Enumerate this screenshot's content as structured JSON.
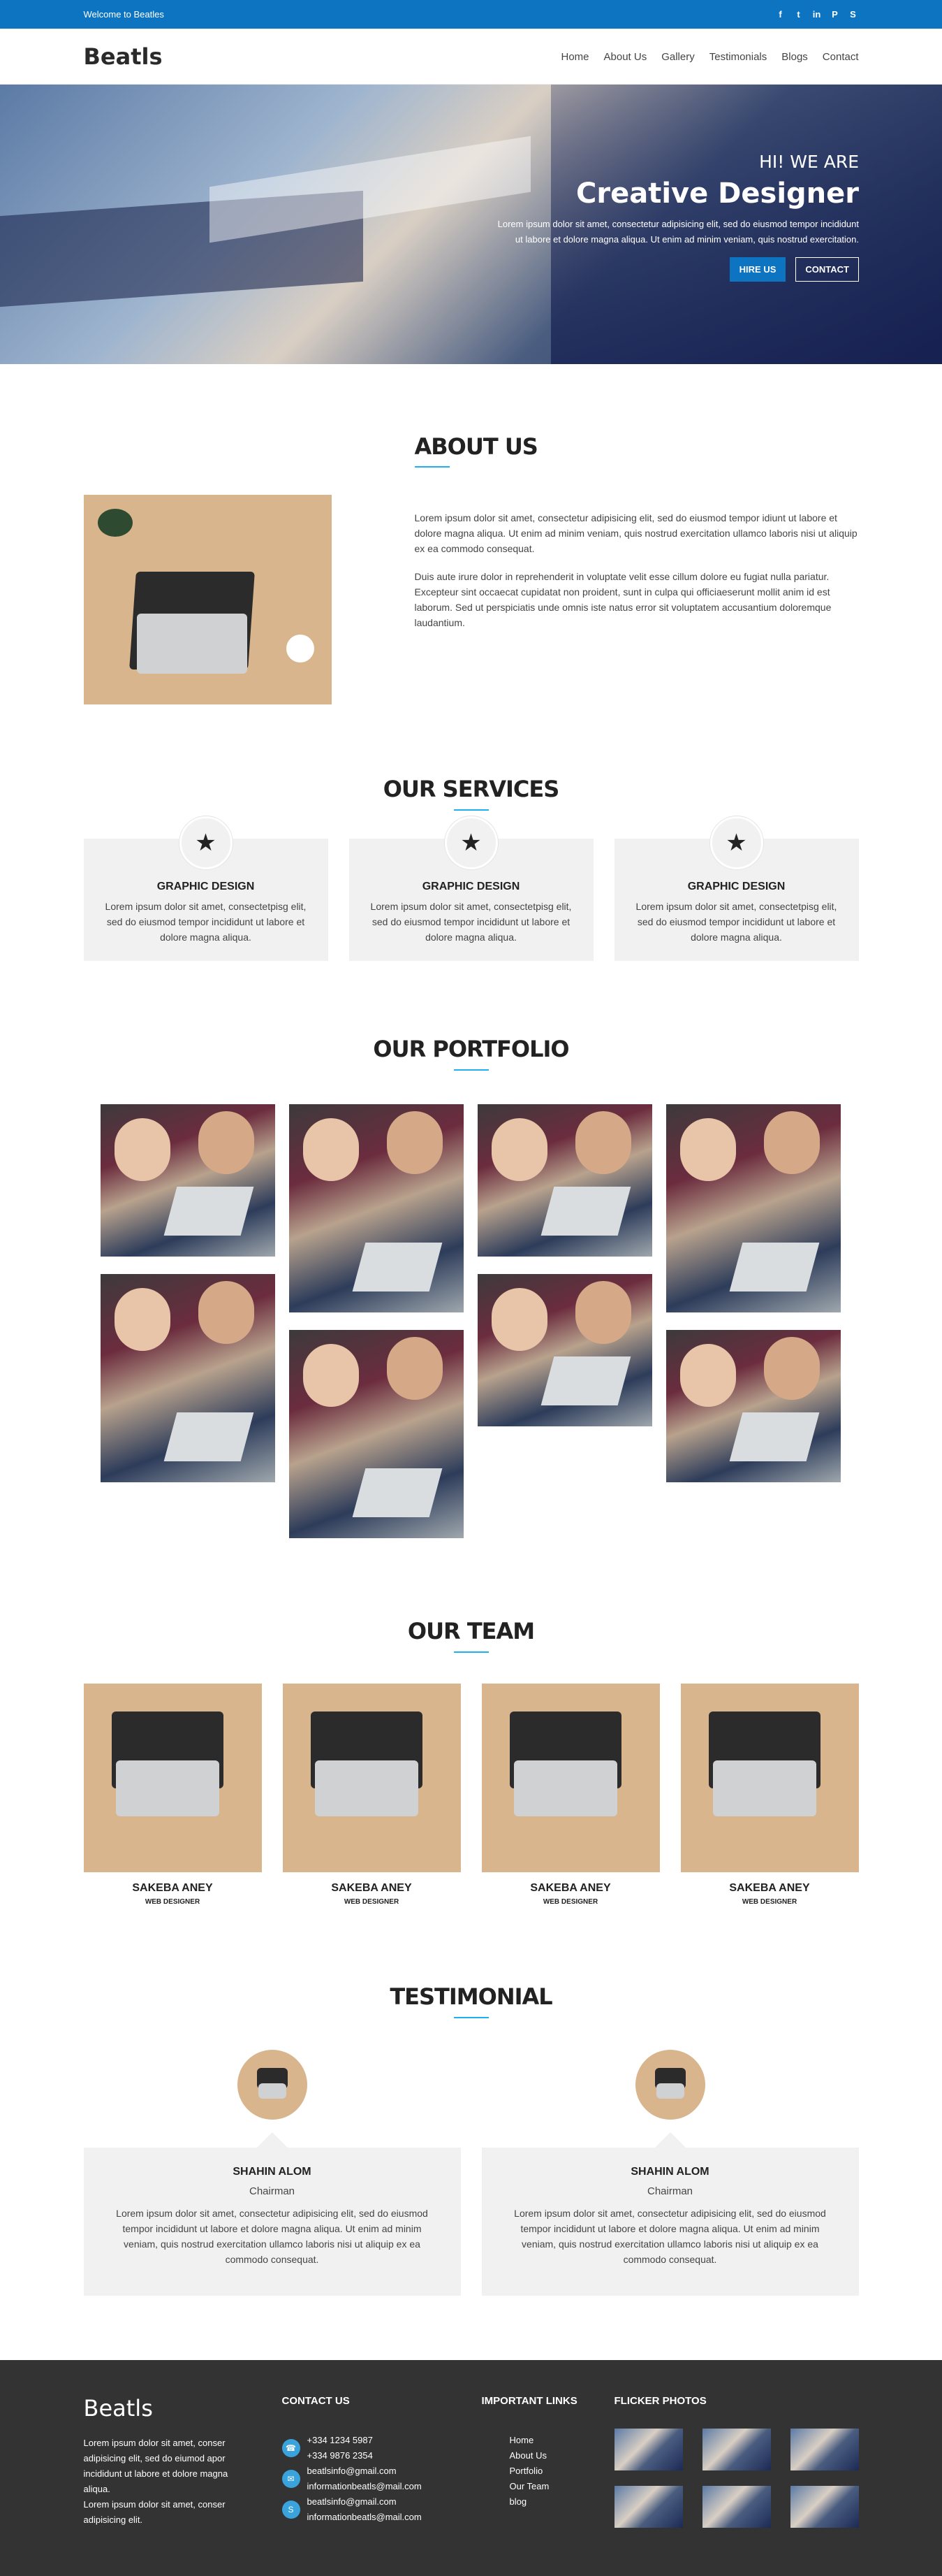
{
  "topbar": {
    "welcome": "Welcome to Beatles",
    "social_icons": [
      "facebook-icon",
      "twitter-icon",
      "linkedin-icon",
      "pinterest-icon",
      "skype-icon"
    ]
  },
  "nav": {
    "logo": "Beatls",
    "items": [
      "Home",
      "About Us",
      "Gallery",
      "Testimonials",
      "Blogs",
      "Contact"
    ]
  },
  "hero": {
    "subtitle": "HI! WE ARE",
    "title": "Creative Designer",
    "description": "Lorem ipsum dolor sit amet, consectetur adipisicing elit, sed do eiusmod tempor incididunt ut labore et dolore magna aliqua. Ut enim ad minim veniam, quis nostrud exercitation.",
    "hire_label": "HIRE US",
    "contact_label": "CONTACT"
  },
  "about": {
    "title": "ABOUT US",
    "paragraph1": "Lorem ipsum dolor sit amet, consectetur adipisicing elit, sed do eiusmod tempor idiunt ut labore et dolore magna aliqua. Ut enim ad minim veniam, quis nostrud exercitation ullamco laboris nisi ut aliquip ex ea commodo consequat.",
    "paragraph2": "Duis aute irure dolor in reprehenderit in voluptate velit esse cillum dolore eu fugiat nulla pariatur. Excepteur sint occaecat cupidatat non proident, sunt in culpa qui officiaeserunt mollit anim id est laborum. Sed ut perspiciatis unde omnis iste natus error sit voluptatem accusantium doloremque laudantium."
  },
  "services": {
    "title": "OUR SERVICES",
    "items": [
      {
        "title": "GRAPHIC DESIGN",
        "desc": "Lorem ipsum dolor sit amet, consectetpisg elit, sed do eiusmod tempor incididunt ut labore et dolore magna aliqua.",
        "icon": "star-icon"
      },
      {
        "title": "GRAPHIC DESIGN",
        "desc": "Lorem ipsum dolor sit amet, consectetpisg elit, sed do eiusmod tempor incididunt ut labore et dolore magna aliqua.",
        "icon": "star-icon"
      },
      {
        "title": "GRAPHIC DESIGN",
        "desc": "Lorem ipsum dolor sit amet, consectetpisg elit, sed do eiusmod tempor incididunt ut labore et dolore magna aliqua.",
        "icon": "star-icon"
      }
    ]
  },
  "portfolio": {
    "title": "OUR PORTFOLIO"
  },
  "team": {
    "title": "OUR TEAM",
    "members": [
      {
        "name": "SAKEBA ANEY",
        "role": "WEB DESIGNER"
      },
      {
        "name": "SAKEBA ANEY",
        "role": "WEB DESIGNER"
      },
      {
        "name": "SAKEBA ANEY",
        "role": "WEB DESIGNER"
      },
      {
        "name": "SAKEBA ANEY",
        "role": "WEB DESIGNER"
      }
    ]
  },
  "testimonial": {
    "title": "TESTIMONIAL",
    "items": [
      {
        "name": "SHAHIN ALOM",
        "role": "Chairman",
        "text": "Lorem ipsum dolor sit amet, consectetur adipisicing elit, sed do eiusmod tempor incididunt ut labore et dolore magna aliqua. Ut enim ad minim veniam, quis nostrud exercitation ullamco laboris nisi ut aliquip ex ea commodo consequat."
      },
      {
        "name": "SHAHIN ALOM",
        "role": "Chairman",
        "text": "Lorem ipsum dolor sit amet, consectetur adipisicing elit, sed do eiusmod tempor incididunt ut labore et dolore magna aliqua. Ut enim ad minim veniam, quis nostrud exercitation ullamco laboris nisi ut aliquip ex ea commodo consequat."
      }
    ]
  },
  "footer": {
    "logo": "Beatls",
    "about1": "Lorem ipsum dolor sit amet, conser adipisicing elit, sed do eiumod apor incididunt ut labore et dolore magna aliqua.",
    "about2": "Lorem ipsum dolor sit amet, conser adipisicing elit.",
    "contact_title": "CONTACT US",
    "phone1": "+334 1234 5987",
    "phone2": "+334 9876 2354",
    "email1": "beatlsinfo@gmail.com",
    "email2": "informationbeatls@mail.com",
    "email3": "beatlsinfo@gmail.com",
    "email4": "informationbeatls@mail.com",
    "links_title": "IMPORTANT LINKS",
    "links": [
      "Home",
      "About Us",
      "Portfolio",
      "Our Team",
      "blog"
    ],
    "photos_title": "FLICKER PHOTOS"
  }
}
